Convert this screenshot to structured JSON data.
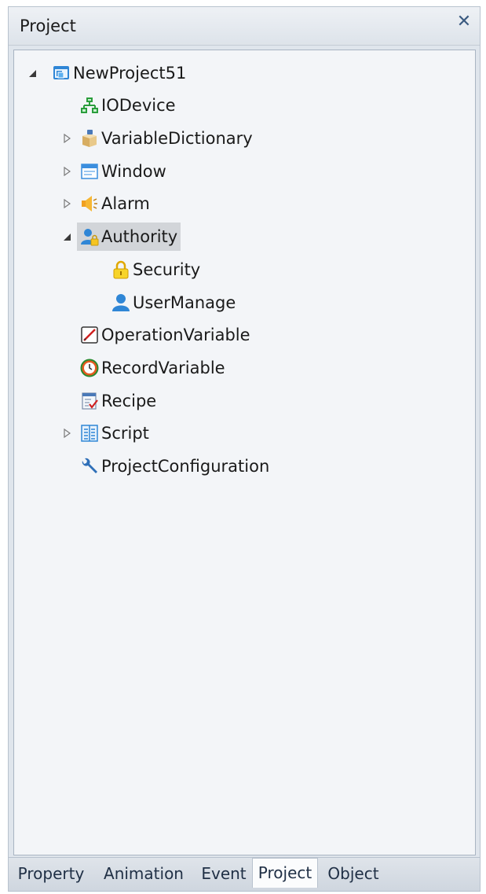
{
  "panel": {
    "title": "Project",
    "close_glyph": "✕"
  },
  "tree": {
    "root": {
      "label": "NewProject51",
      "icon": "project-icon",
      "expanded": true
    },
    "items": [
      {
        "label": "IODevice",
        "icon": "network-icon",
        "expandable": false
      },
      {
        "label": "VariableDictionary",
        "icon": "box-icon",
        "expandable": true,
        "expanded": false
      },
      {
        "label": "Window",
        "icon": "window-icon",
        "expandable": true,
        "expanded": false
      },
      {
        "label": "Alarm",
        "icon": "speaker-icon",
        "expandable": true,
        "expanded": false
      },
      {
        "label": "Authority",
        "icon": "user-lock-icon",
        "expandable": true,
        "expanded": true,
        "selected": true,
        "children": [
          {
            "label": "Security",
            "icon": "lock-icon"
          },
          {
            "label": "UserManage",
            "icon": "user-icon"
          }
        ]
      },
      {
        "label": "OperationVariable",
        "icon": "pen-icon",
        "expandable": false
      },
      {
        "label": "RecordVariable",
        "icon": "clock-icon",
        "expandable": false
      },
      {
        "label": "Recipe",
        "icon": "checklist-icon",
        "expandable": false
      },
      {
        "label": "Script",
        "icon": "script-icon",
        "expandable": true,
        "expanded": false
      },
      {
        "label": "ProjectConfiguration",
        "icon": "wrench-icon",
        "expandable": false
      }
    ]
  },
  "tabs": [
    {
      "label": "Property",
      "active": false
    },
    {
      "label": "Animation",
      "active": false
    },
    {
      "label": "Event",
      "active": false
    },
    {
      "label": "Project",
      "active": true
    },
    {
      "label": "Object",
      "active": false
    }
  ],
  "colors": {
    "panel_bg": "#dfe5ec",
    "tree_bg": "#f3f5f8",
    "selection_bg": "#d2d5d9",
    "accent_blue": "#2f86d6"
  }
}
